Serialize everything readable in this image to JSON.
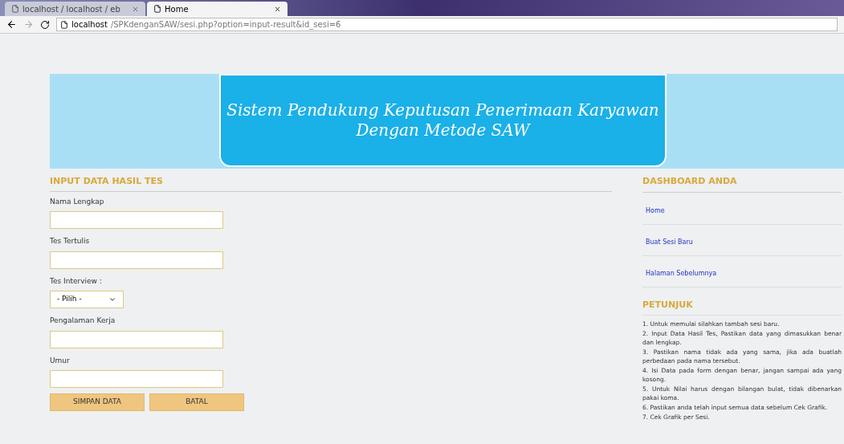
{
  "browser": {
    "tabs": [
      {
        "title": "localhost / localhost / eb",
        "selected": false
      },
      {
        "title": "Home",
        "selected": true
      }
    ],
    "url_host": "localhost",
    "url_path": "/SPKdenganSAW/sesi.php?option=input-result&id_sesi=6"
  },
  "banner": {
    "title_line_1": "Sistem Pendukung Keputusan Penerimaan Karyawan",
    "title_line_2": "Dengan Metode SAW"
  },
  "form": {
    "heading": "INPUT DATA HASIL TES",
    "fields": [
      {
        "kind": "text",
        "label": "Nama Lengkap"
      },
      {
        "kind": "text",
        "label": "Tes Tertulis"
      },
      {
        "kind": "select",
        "label": "Tes Interview :",
        "value": "- Pilih -"
      },
      {
        "kind": "text",
        "label": "Pengalaman Kerja"
      },
      {
        "kind": "text",
        "label": "Umur"
      }
    ],
    "buttons": [
      "SIMPAN DATA",
      "BATAL"
    ]
  },
  "dashboard": {
    "heading": "DASHBOARD ANDA",
    "links": [
      "Home",
      "Buat Sesi Baru",
      "Halaman Sebelumnya"
    ]
  },
  "petunjuk": {
    "heading": "PETUNJUK",
    "items": [
      "1. Untuk memulai silahkan tambah sesi baru.",
      "2. Input Data Hasil Tes, Pastikan data yang dimasukkan benar dan lengkap.",
      "3. Pastikan nama tidak ada yang sama, jika ada buatlah perbedaan pada nama tersebut.",
      "4. Isi Data pada form dengan benar, jangan sampai ada yang kosong.",
      "5. Untuk Nilai harus dengan bilangan bulat, tidak dibenarkan pakai koma.",
      "6. Pastikan anda telah input semua data sebelum Cek Grafik.",
      "7. Cek Grafik per Sesi."
    ]
  }
}
